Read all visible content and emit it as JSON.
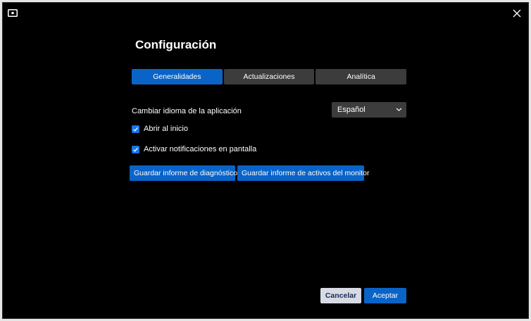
{
  "app": {
    "title": "Configuración"
  },
  "tabs": [
    {
      "label": "Generalidades",
      "active": true
    },
    {
      "label": "Actualizaciones",
      "active": false
    },
    {
      "label": "Analítica",
      "active": false
    }
  ],
  "language": {
    "label": "Cambiar idioma de la aplicación",
    "selected": "Español"
  },
  "options": [
    {
      "label": "Abrir al inicio",
      "checked": true
    },
    {
      "label": "Activar notificaciones en pantalla",
      "checked": true
    }
  ],
  "actions": {
    "diagnostic_label": "Guardar informe de diagnóstico",
    "assets_label": "Guardar informe de activos del monitor"
  },
  "footer": {
    "cancel_label": "Cancelar",
    "accept_label": "Aceptar"
  },
  "colors": {
    "background": "#000000",
    "accent": "#0a64c8",
    "tab_inactive": "#3c3c3c",
    "cancel_bg": "#d8dbe3"
  },
  "icons": {
    "app": "monitor-icon",
    "close": "close-icon",
    "dropdown": "chevron-down-icon",
    "check": "check-icon"
  }
}
